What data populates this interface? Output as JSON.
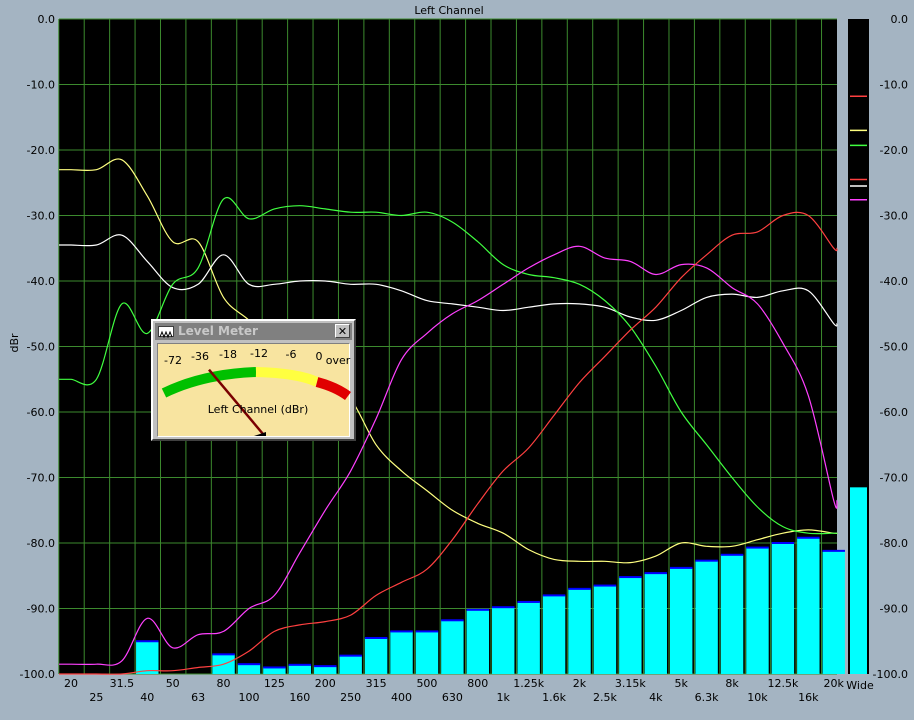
{
  "chart_data": {
    "type": "line",
    "title": "Left Channel",
    "ylabel": "dBr",
    "ylim": [
      -100,
      0
    ],
    "y_ticks": [
      {
        "v": 0,
        "label": "0.0"
      },
      {
        "v": -10,
        "label": "-10.0"
      },
      {
        "v": -20,
        "label": "-20.0"
      },
      {
        "v": -30,
        "label": "-30.0"
      },
      {
        "v": -40,
        "label": "-40.0"
      },
      {
        "v": -50,
        "label": "-50.0"
      },
      {
        "v": -60,
        "label": "-60.0"
      },
      {
        "v": -70,
        "label": "-70.0"
      },
      {
        "v": -80,
        "label": "-80.0"
      },
      {
        "v": -90,
        "label": "-90.0"
      },
      {
        "v": -100,
        "label": "-100.0"
      }
    ],
    "x_scale": "log",
    "bands": [
      "20",
      "25",
      "31.5",
      "40",
      "50",
      "63",
      "80",
      "100",
      "125",
      "160",
      "200",
      "250",
      "315",
      "400",
      "500",
      "630",
      "800",
      "1k",
      "1.25k",
      "1.6k",
      "2k",
      "2.5k",
      "3.15k",
      "4k",
      "5k",
      "6.3k",
      "8k",
      "10k",
      "12.5k",
      "16k",
      "20k"
    ],
    "bars": {
      "name": "1/3 octave",
      "color": "#00ffff",
      "values": [
        -100,
        -100,
        -100,
        -95,
        -100,
        -100,
        -97,
        -98.5,
        -99,
        -98.6,
        -98.8,
        -97.2,
        -94.5,
        -93.5,
        -93.5,
        -91.8,
        -90.2,
        -89.8,
        -89,
        -88,
        -87,
        -86.5,
        -85.2,
        -84.6,
        -83.8,
        -82.7,
        -81.8,
        -80.7,
        -80,
        -79.2,
        -81.2
      ],
      "peak_color": "#0000ff"
    },
    "series": [
      {
        "color": "#ffff80",
        "y": [
          -23,
          -23,
          -21.5,
          -27,
          -34,
          -34,
          -42.5,
          -46,
          -50,
          -52,
          -55,
          -58,
          -65,
          -69,
          -72,
          -75,
          -77,
          -78.5,
          -81,
          -82.5,
          -82.8,
          -82.8,
          -83,
          -82,
          -80,
          -80.5,
          -80.5,
          -79.5,
          -78.5,
          -78,
          -78.5
        ]
      },
      {
        "color": "#ffffff",
        "y": [
          -34.5,
          -34.5,
          -33,
          -37,
          -41,
          -40.5,
          -36,
          -40.5,
          -40.5,
          -40,
          -40,
          -40.5,
          -40.5,
          -41.5,
          -43,
          -43.5,
          -44,
          -44.5,
          -44,
          -43.5,
          -43.5,
          -44,
          -45.5,
          -46,
          -44.5,
          -42.5,
          -42,
          -42.5,
          -41.5,
          -41.5,
          -46.5
        ]
      },
      {
        "color": "#40ff40",
        "y": [
          -55,
          -55,
          -43.5,
          -48,
          -40.5,
          -38,
          -27.5,
          -30.5,
          -29,
          -28.5,
          -29,
          -29.5,
          -29.5,
          -30,
          -29.5,
          -31,
          -34,
          -37.5,
          -39,
          -39.5,
          -40.5,
          -43,
          -47,
          -53,
          -60,
          -65,
          -70,
          -74.5,
          -77.5,
          -78.5,
          -78.5
        ]
      },
      {
        "color": "#ff40ff",
        "y": [
          -98.5,
          -98.5,
          -98,
          -91.5,
          -96,
          -94,
          -93.5,
          -90,
          -88,
          -81.5,
          -75,
          -69,
          -61,
          -52,
          -48,
          -45,
          -43,
          -40.5,
          -38,
          -36,
          -34.7,
          -36.5,
          -37,
          -39,
          -37.5,
          -38,
          -41,
          -43.5,
          -49.5,
          -57.5,
          -73.5
        ]
      },
      {
        "color": "#ff4040",
        "y": [
          -100,
          -100,
          -100,
          -99.5,
          -99.5,
          -99,
          -98.5,
          -96.5,
          -93.5,
          -92.5,
          -92,
          -91,
          -88,
          -86,
          -84,
          -79.5,
          -74,
          -69,
          -65.5,
          -60.5,
          -55.5,
          -51.5,
          -47.5,
          -44,
          -39.5,
          -36,
          -33,
          -32.5,
          -30,
          -30,
          -35
        ]
      }
    ],
    "right_bar": {
      "label": "Wide",
      "value": -71.5,
      "color": "#00ffff"
    },
    "right_markers": [
      {
        "v": -11.8,
        "color": "#ff4040"
      },
      {
        "v": -17.0,
        "color": "#ffff80"
      },
      {
        "v": -19.3,
        "color": "#40ff40"
      },
      {
        "v": -24.5,
        "color": "#ff4040"
      },
      {
        "v": -25.5,
        "color": "#ffffff"
      },
      {
        "v": -27.6,
        "color": "#ff40ff"
      }
    ]
  },
  "level_meter": {
    "window_title": "Level Meter",
    "close_label": "✕",
    "caption": "Left Channel (dBr)",
    "scale_labels": [
      "-72",
      "-36",
      "-18",
      "-12",
      "-6",
      "0",
      "over"
    ],
    "needle_value": -36
  }
}
